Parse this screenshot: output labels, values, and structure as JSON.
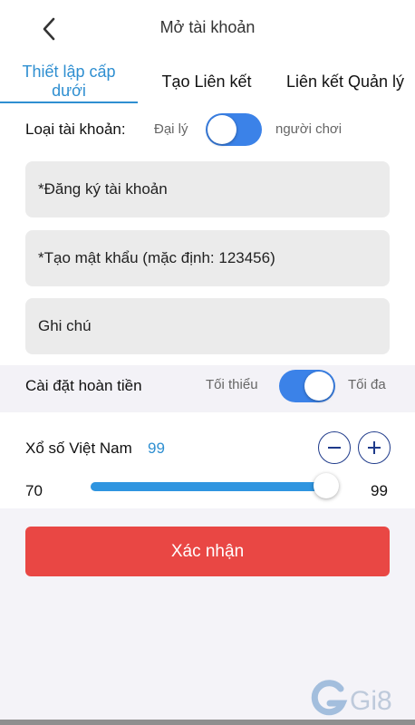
{
  "header": {
    "title": "Mở tài khoản",
    "back_icon": "chevron-left-icon"
  },
  "tabs": [
    {
      "label_line1": "Thiết lập cấp",
      "label_line2": "dưới",
      "active": true
    },
    {
      "label": "Tạo Liên kết",
      "active": false
    },
    {
      "label": "Liên kết Quản lý",
      "active": false
    }
  ],
  "account_type": {
    "label": "Loại tài khoản:",
    "left_option": "Đại lý",
    "right_option": "người chơi",
    "toggle_on": true
  },
  "fields": {
    "username_placeholder": "*Đăng ký tài khoản",
    "password_placeholder": "*Tạo mật khẩu (mặc định: 123456)",
    "note_placeholder": "Ghi chú"
  },
  "cashback": {
    "label": "Cài đặt hoàn tiền",
    "left_option": "Tối thiểu",
    "right_option": "Tối đa",
    "toggle_on": true
  },
  "lottery": {
    "name": "Xổ số Việt Nam",
    "current_value": "99",
    "min_label": "70",
    "max_label": "99",
    "slider_min": 70,
    "slider_max": 99,
    "slider_value": 99,
    "minus_icon": "minus-circle-icon",
    "plus_icon": "plus-circle-icon"
  },
  "confirm_label": "Xác nhận",
  "watermark": {
    "text": "Gi8"
  },
  "colors": {
    "accent_blue": "#2f8fd1",
    "toggle_blue": "#3b82e8",
    "confirm_red": "#e94744"
  }
}
